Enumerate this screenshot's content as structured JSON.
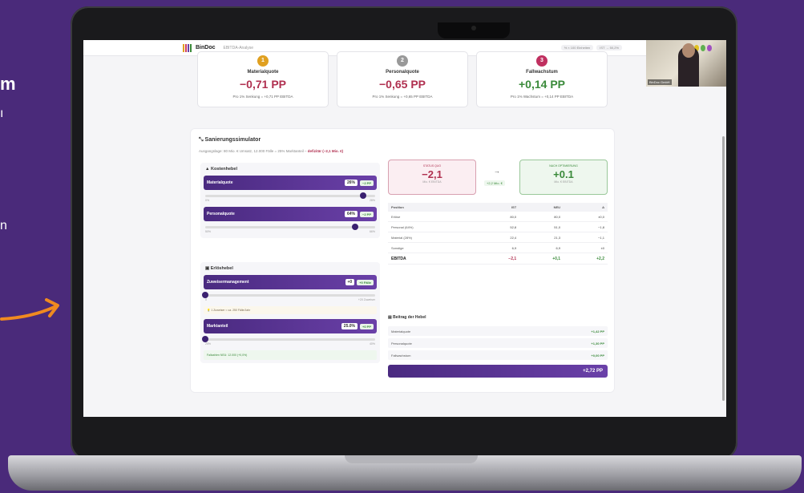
{
  "slide": {
    "frag_title": "m",
    "frag_line1": "ı",
    "frag_line2": "n"
  },
  "app": {
    "brand": "BinDoc",
    "crumb": "EBITDA-Analyse",
    "top_pills": [
      "% × 100 Einheiten",
      "IST → 50,2%"
    ],
    "logo_colors": [
      "#e0a020",
      "#d04060",
      "#6a40a8",
      "#3a8a3a"
    ]
  },
  "webcam": {
    "label": "BinDoc GmbH"
  },
  "kpis": [
    {
      "num": "1",
      "title": "Materialquote",
      "value": "−0,71 PP",
      "sub": "Pro 1% Senkung = +0,71 PP EBITDA",
      "num_color": "#e0a020",
      "value_color": "#b03050"
    },
    {
      "num": "2",
      "title": "Personalquote",
      "value": "−0,65 PP",
      "sub": "Pro 1% Senkung = +0,65 PP EBITDA",
      "num_color": "#999999",
      "value_color": "#b03050"
    },
    {
      "num": "3",
      "title": "Fallwachstum",
      "value": "+0,14 PP",
      "sub": "Pro 1% Wachstum = +0,14 PP EBITDA",
      "num_color": "#c03060",
      "value_color": "#3a8a3a"
    }
  ],
  "simulator": {
    "title": "Sanierungssimulator",
    "subtitle_prefix": "Ausgangslage: 80 Mio. € Umsatz, 12.000 Fälle = 25% Marktanteil –",
    "subtitle_emph": "defizitär (−2,1 Mio. €)",
    "cost_header": "Kostenhebel",
    "revenue_header": "Erlöshebel",
    "levers": {
      "material": {
        "label": "Materialquote",
        "value": "26%",
        "delta": "−2 PP",
        "min": "0%",
        "max": "28%",
        "level": 0.93
      },
      "personal": {
        "label": "Personalquote",
        "value": "64%",
        "delta": "−2 PP",
        "min": "50%",
        "max": "66%",
        "level": 0.88
      },
      "zuweiser": {
        "label": "Zuweisermanagement",
        "value": "+0",
        "delta": "+0 Fälle",
        "min": "0",
        "max": "+20 Zuweiser",
        "level": 0.0,
        "hint": "1 Zuweiser = ca. 250 Fälle/Jahr"
      },
      "markt": {
        "label": "Marktanteil",
        "value": "25.0%",
        "delta": "+0 PP",
        "min": "25%",
        "max": "40%",
        "level": 0.0,
        "result": "Fallzahlen NEU: 12.000 (+0,0%)"
      }
    }
  },
  "status": {
    "ist_label": "STATUS QUO",
    "ist_value": "−2,1",
    "ist_sub": "Mio. € EBITDA",
    "arrow": "→",
    "mid_badge": "+2,2 Mio. €",
    "neu_label": "NACH OPTIMIERUNG",
    "neu_value": "+0.1",
    "neu_sub": "Mio. € EBITDA"
  },
  "table": {
    "headers": [
      "Position",
      "IST",
      "NEU",
      "Δ"
    ],
    "rows": [
      [
        "Erlöse",
        "80,0",
        "80,0",
        "±0,0"
      ],
      [
        "Personal (64%)",
        "52,8",
        "51,0",
        "−1,8"
      ],
      [
        "Material (28%)",
        "22,4",
        "21,3",
        "−1,1"
      ],
      [
        "Sonstige",
        "6,9",
        "6,9",
        "±0"
      ]
    ],
    "total": [
      "EBITDA",
      "−2,1",
      "+0,1",
      "+2,2"
    ]
  },
  "contributions": {
    "title": "Beitrag der Hebel",
    "items": [
      {
        "label": "Materialquote",
        "value": "+1,42 PP"
      },
      {
        "label": "Personalquote",
        "value": "+1,30 PP"
      },
      {
        "label": "Fallwachstum",
        "value": "+0,00 PP"
      }
    ],
    "total": "+2,72 PP"
  }
}
